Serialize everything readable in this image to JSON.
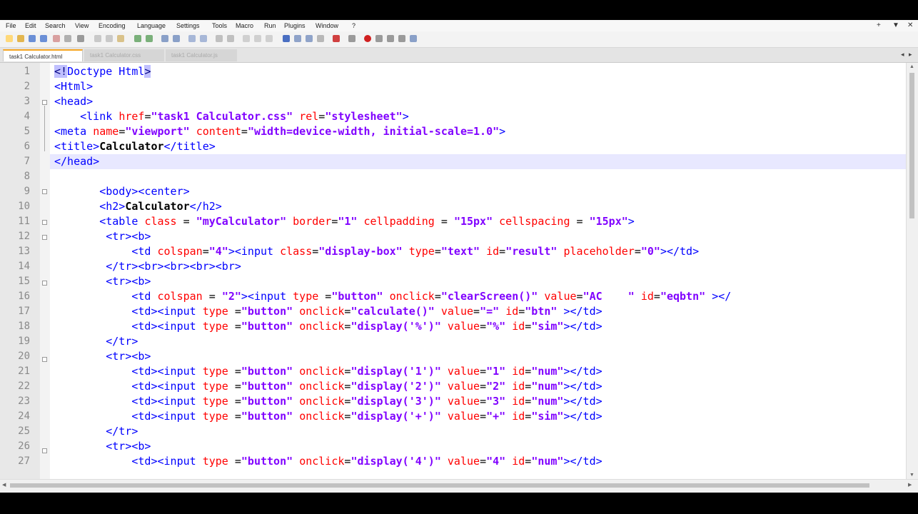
{
  "menu": [
    "File",
    "Edit",
    "Search",
    "View",
    "Encoding",
    "Language",
    "Settings",
    "Tools",
    "Macro",
    "Run",
    "Plugins",
    "Window",
    "?"
  ],
  "window_controls": {
    "plus": "+",
    "down": "▼",
    "close": "✕"
  },
  "tabs": [
    {
      "label": "task1 Calculator.html"
    },
    {
      "label": "task1 Calculator.css"
    },
    {
      "label": "task1 Calculator.js"
    }
  ],
  "editor": {
    "current_line": 7,
    "line_numbers": [
      "1",
      "2",
      "3",
      "4",
      "5",
      "6",
      "7",
      "8",
      "9",
      "10",
      "11",
      "12",
      "13",
      "14",
      "15",
      "16",
      "17",
      "18",
      "19",
      "20",
      "21",
      "22",
      "23",
      "24",
      "25",
      "26",
      "27"
    ],
    "lines": [
      {
        "s": [
          {
            "c": "sel",
            "t": "<!"
          },
          {
            "c": "tg",
            "t": "Doctype Html"
          },
          {
            "c": "sel",
            "t": ">"
          }
        ]
      },
      {
        "s": [
          {
            "c": "tg",
            "t": "<Html>"
          }
        ]
      },
      {
        "s": [
          {
            "c": "tg",
            "t": "<head>"
          }
        ]
      },
      {
        "s": [
          {
            "c": "p",
            "t": "    "
          },
          {
            "c": "tg",
            "t": "<link "
          },
          {
            "c": "at",
            "t": "href"
          },
          {
            "c": "p",
            "t": "="
          },
          {
            "c": "vv",
            "t": "\"task1 Calculator.css\""
          },
          {
            "c": "p",
            "t": " "
          },
          {
            "c": "at",
            "t": "rel"
          },
          {
            "c": "p",
            "t": "="
          },
          {
            "c": "vv",
            "t": "\"stylesheet\""
          },
          {
            "c": "tg",
            "t": ">"
          }
        ]
      },
      {
        "s": [
          {
            "c": "tg",
            "t": "<meta "
          },
          {
            "c": "at",
            "t": "name"
          },
          {
            "c": "p",
            "t": "="
          },
          {
            "c": "vv",
            "t": "\"viewport\""
          },
          {
            "c": "p",
            "t": " "
          },
          {
            "c": "at",
            "t": "content"
          },
          {
            "c": "p",
            "t": "="
          },
          {
            "c": "vv",
            "t": "\"width=device-width, initial-scale=1.0\""
          },
          {
            "c": "tg",
            "t": ">"
          }
        ]
      },
      {
        "s": [
          {
            "c": "tg",
            "t": "<title>"
          },
          {
            "c": "tx",
            "t": "Calculator"
          },
          {
            "c": "tg",
            "t": "</title>"
          }
        ]
      },
      {
        "s": [
          {
            "c": "tg",
            "t": "</head>"
          }
        ]
      },
      {
        "s": []
      },
      {
        "s": [
          {
            "c": "p",
            "t": "       "
          },
          {
            "c": "tg",
            "t": "<body><center>"
          }
        ]
      },
      {
        "s": [
          {
            "c": "p",
            "t": "       "
          },
          {
            "c": "tg",
            "t": "<h2>"
          },
          {
            "c": "tx",
            "t": "Calculator"
          },
          {
            "c": "tg",
            "t": "</h2>"
          }
        ]
      },
      {
        "s": [
          {
            "c": "p",
            "t": "       "
          },
          {
            "c": "tg",
            "t": "<table "
          },
          {
            "c": "at",
            "t": "class"
          },
          {
            "c": "p",
            "t": " = "
          },
          {
            "c": "vv",
            "t": "\"myCalculator\""
          },
          {
            "c": "p",
            "t": " "
          },
          {
            "c": "at",
            "t": "border"
          },
          {
            "c": "p",
            "t": "="
          },
          {
            "c": "vv",
            "t": "\"1\""
          },
          {
            "c": "p",
            "t": " "
          },
          {
            "c": "at",
            "t": "cellpadding"
          },
          {
            "c": "p",
            "t": " = "
          },
          {
            "c": "vv",
            "t": "\"15px\""
          },
          {
            "c": "p",
            "t": " "
          },
          {
            "c": "at",
            "t": "cellspacing"
          },
          {
            "c": "p",
            "t": " = "
          },
          {
            "c": "vv",
            "t": "\"15px\""
          },
          {
            "c": "tg",
            "t": ">"
          }
        ]
      },
      {
        "s": [
          {
            "c": "p",
            "t": "        "
          },
          {
            "c": "tg",
            "t": "<tr><b>"
          }
        ]
      },
      {
        "s": [
          {
            "c": "p",
            "t": "            "
          },
          {
            "c": "tg",
            "t": "<td "
          },
          {
            "c": "at",
            "t": "colspan"
          },
          {
            "c": "p",
            "t": "="
          },
          {
            "c": "vv",
            "t": "\"4\""
          },
          {
            "c": "tg",
            "t": "><input "
          },
          {
            "c": "at",
            "t": "class"
          },
          {
            "c": "p",
            "t": "="
          },
          {
            "c": "vv",
            "t": "\"display-box\""
          },
          {
            "c": "p",
            "t": " "
          },
          {
            "c": "at",
            "t": "type"
          },
          {
            "c": "p",
            "t": "="
          },
          {
            "c": "vv",
            "t": "\"text\""
          },
          {
            "c": "p",
            "t": " "
          },
          {
            "c": "at",
            "t": "id"
          },
          {
            "c": "p",
            "t": "="
          },
          {
            "c": "vv",
            "t": "\"result\""
          },
          {
            "c": "p",
            "t": " "
          },
          {
            "c": "at",
            "t": "placeholder"
          },
          {
            "c": "p",
            "t": "="
          },
          {
            "c": "vv",
            "t": "\"0\""
          },
          {
            "c": "tg",
            "t": "></td>"
          }
        ]
      },
      {
        "s": [
          {
            "c": "p",
            "t": "        "
          },
          {
            "c": "tg",
            "t": "</tr><br><br><br><br>"
          }
        ]
      },
      {
        "s": [
          {
            "c": "p",
            "t": "        "
          },
          {
            "c": "tg",
            "t": "<tr><b>"
          }
        ]
      },
      {
        "s": [
          {
            "c": "p",
            "t": "            "
          },
          {
            "c": "tg",
            "t": "<td "
          },
          {
            "c": "at",
            "t": "colspan"
          },
          {
            "c": "p",
            "t": " = "
          },
          {
            "c": "vv",
            "t": "\"2\""
          },
          {
            "c": "tg",
            "t": "><input "
          },
          {
            "c": "at",
            "t": "type"
          },
          {
            "c": "p",
            "t": " ="
          },
          {
            "c": "vv",
            "t": "\"button\""
          },
          {
            "c": "p",
            "t": " "
          },
          {
            "c": "at",
            "t": "onclick"
          },
          {
            "c": "p",
            "t": "="
          },
          {
            "c": "vv",
            "t": "\"clearScreen()\""
          },
          {
            "c": "p",
            "t": " "
          },
          {
            "c": "at",
            "t": "value"
          },
          {
            "c": "p",
            "t": "="
          },
          {
            "c": "vv",
            "t": "\"AC    \""
          },
          {
            "c": "p",
            "t": " "
          },
          {
            "c": "at",
            "t": "id"
          },
          {
            "c": "p",
            "t": "="
          },
          {
            "c": "vv",
            "t": "\"eqbtn\""
          },
          {
            "c": "p",
            "t": " "
          },
          {
            "c": "tg",
            "t": "></"
          }
        ]
      },
      {
        "s": [
          {
            "c": "p",
            "t": "            "
          },
          {
            "c": "tg",
            "t": "<td><input "
          },
          {
            "c": "at",
            "t": "type"
          },
          {
            "c": "p",
            "t": " ="
          },
          {
            "c": "vv",
            "t": "\"button\""
          },
          {
            "c": "p",
            "t": " "
          },
          {
            "c": "at",
            "t": "onclick"
          },
          {
            "c": "p",
            "t": "="
          },
          {
            "c": "vv",
            "t": "\"calculate()\""
          },
          {
            "c": "p",
            "t": " "
          },
          {
            "c": "at",
            "t": "value"
          },
          {
            "c": "p",
            "t": "="
          },
          {
            "c": "vv",
            "t": "\"=\""
          },
          {
            "c": "p",
            "t": " "
          },
          {
            "c": "at",
            "t": "id"
          },
          {
            "c": "p",
            "t": "="
          },
          {
            "c": "vv",
            "t": "\"btn\""
          },
          {
            "c": "p",
            "t": " "
          },
          {
            "c": "tg",
            "t": "></td>"
          }
        ]
      },
      {
        "s": [
          {
            "c": "p",
            "t": "            "
          },
          {
            "c": "tg",
            "t": "<td><input "
          },
          {
            "c": "at",
            "t": "type"
          },
          {
            "c": "p",
            "t": " ="
          },
          {
            "c": "vv",
            "t": "\"button\""
          },
          {
            "c": "p",
            "t": " "
          },
          {
            "c": "at",
            "t": "onclick"
          },
          {
            "c": "p",
            "t": "="
          },
          {
            "c": "vv",
            "t": "\"display('%')\""
          },
          {
            "c": "p",
            "t": " "
          },
          {
            "c": "at",
            "t": "value"
          },
          {
            "c": "p",
            "t": "="
          },
          {
            "c": "vv",
            "t": "\"%\""
          },
          {
            "c": "p",
            "t": " "
          },
          {
            "c": "at",
            "t": "id"
          },
          {
            "c": "p",
            "t": "="
          },
          {
            "c": "vv",
            "t": "\"sim\""
          },
          {
            "c": "tg",
            "t": "></td>"
          }
        ]
      },
      {
        "s": [
          {
            "c": "p",
            "t": "        "
          },
          {
            "c": "tg",
            "t": "</tr>"
          }
        ]
      },
      {
        "s": [
          {
            "c": "p",
            "t": "        "
          },
          {
            "c": "tg",
            "t": "<tr><b>"
          }
        ]
      },
      {
        "s": [
          {
            "c": "p",
            "t": "            "
          },
          {
            "c": "tg",
            "t": "<td><input "
          },
          {
            "c": "at",
            "t": "type"
          },
          {
            "c": "p",
            "t": " ="
          },
          {
            "c": "vv",
            "t": "\"button\""
          },
          {
            "c": "p",
            "t": " "
          },
          {
            "c": "at",
            "t": "onclick"
          },
          {
            "c": "p",
            "t": "="
          },
          {
            "c": "vv",
            "t": "\"display('1')\""
          },
          {
            "c": "p",
            "t": " "
          },
          {
            "c": "at",
            "t": "value"
          },
          {
            "c": "p",
            "t": "="
          },
          {
            "c": "vv",
            "t": "\"1\""
          },
          {
            "c": "p",
            "t": " "
          },
          {
            "c": "at",
            "t": "id"
          },
          {
            "c": "p",
            "t": "="
          },
          {
            "c": "vv",
            "t": "\"num\""
          },
          {
            "c": "tg",
            "t": "></td>"
          }
        ]
      },
      {
        "s": [
          {
            "c": "p",
            "t": "            "
          },
          {
            "c": "tg",
            "t": "<td><input "
          },
          {
            "c": "at",
            "t": "type"
          },
          {
            "c": "p",
            "t": " ="
          },
          {
            "c": "vv",
            "t": "\"button\""
          },
          {
            "c": "p",
            "t": " "
          },
          {
            "c": "at",
            "t": "onclick"
          },
          {
            "c": "p",
            "t": "="
          },
          {
            "c": "vv",
            "t": "\"display('2')\""
          },
          {
            "c": "p",
            "t": " "
          },
          {
            "c": "at",
            "t": "value"
          },
          {
            "c": "p",
            "t": "="
          },
          {
            "c": "vv",
            "t": "\"2\""
          },
          {
            "c": "p",
            "t": " "
          },
          {
            "c": "at",
            "t": "id"
          },
          {
            "c": "p",
            "t": "="
          },
          {
            "c": "vv",
            "t": "\"num\""
          },
          {
            "c": "tg",
            "t": "></td>"
          }
        ]
      },
      {
        "s": [
          {
            "c": "p",
            "t": "            "
          },
          {
            "c": "tg",
            "t": "<td><input "
          },
          {
            "c": "at",
            "t": "type"
          },
          {
            "c": "p",
            "t": " ="
          },
          {
            "c": "vv",
            "t": "\"button\""
          },
          {
            "c": "p",
            "t": " "
          },
          {
            "c": "at",
            "t": "onclick"
          },
          {
            "c": "p",
            "t": "="
          },
          {
            "c": "vv",
            "t": "\"display('3')\""
          },
          {
            "c": "p",
            "t": " "
          },
          {
            "c": "at",
            "t": "value"
          },
          {
            "c": "p",
            "t": "="
          },
          {
            "c": "vv",
            "t": "\"3\""
          },
          {
            "c": "p",
            "t": " "
          },
          {
            "c": "at",
            "t": "id"
          },
          {
            "c": "p",
            "t": "="
          },
          {
            "c": "vv",
            "t": "\"num\""
          },
          {
            "c": "tg",
            "t": "></td>"
          }
        ]
      },
      {
        "s": [
          {
            "c": "p",
            "t": "            "
          },
          {
            "c": "tg",
            "t": "<td><input "
          },
          {
            "c": "at",
            "t": "type"
          },
          {
            "c": "p",
            "t": " ="
          },
          {
            "c": "vv",
            "t": "\"button\""
          },
          {
            "c": "p",
            "t": " "
          },
          {
            "c": "at",
            "t": "onclick"
          },
          {
            "c": "p",
            "t": "="
          },
          {
            "c": "vv",
            "t": "\"display('+')\""
          },
          {
            "c": "p",
            "t": " "
          },
          {
            "c": "at",
            "t": "value"
          },
          {
            "c": "p",
            "t": "="
          },
          {
            "c": "vv",
            "t": "\"+\""
          },
          {
            "c": "p",
            "t": " "
          },
          {
            "c": "at",
            "t": "id"
          },
          {
            "c": "p",
            "t": "="
          },
          {
            "c": "vv",
            "t": "\"sim\""
          },
          {
            "c": "tg",
            "t": "></td>"
          }
        ]
      },
      {
        "s": [
          {
            "c": "p",
            "t": "        "
          },
          {
            "c": "tg",
            "t": "</tr>"
          }
        ]
      },
      {
        "s": [
          {
            "c": "p",
            "t": "        "
          },
          {
            "c": "tg",
            "t": "<tr><b>"
          }
        ]
      },
      {
        "s": [
          {
            "c": "p",
            "t": "            "
          },
          {
            "c": "tg",
            "t": "<td><input "
          },
          {
            "c": "at",
            "t": "type"
          },
          {
            "c": "p",
            "t": " ="
          },
          {
            "c": "vv",
            "t": "\"button\""
          },
          {
            "c": "p",
            "t": " "
          },
          {
            "c": "at",
            "t": "onclick"
          },
          {
            "c": "p",
            "t": "="
          },
          {
            "c": "vv",
            "t": "\"display('4')\""
          },
          {
            "c": "p",
            "t": " "
          },
          {
            "c": "at",
            "t": "value"
          },
          {
            "c": "p",
            "t": "="
          },
          {
            "c": "vv",
            "t": "\"4\""
          },
          {
            "c": "p",
            "t": " "
          },
          {
            "c": "at",
            "t": "id"
          },
          {
            "c": "p",
            "t": "="
          },
          {
            "c": "vv",
            "t": "\"num\""
          },
          {
            "c": "tg",
            "t": "></td>"
          }
        ]
      }
    ]
  }
}
